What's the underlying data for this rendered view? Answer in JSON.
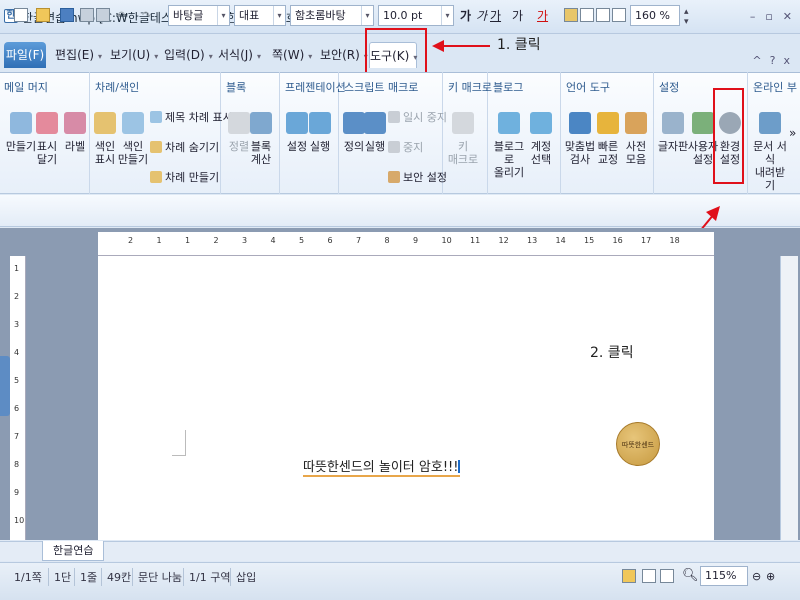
{
  "window": {
    "title": "한글연습.hwp [C:₩한글테스트01₩] - 한컴오피스 호글",
    "minimize": "–",
    "restore": "▫",
    "close": "✕"
  },
  "menu": {
    "file": "파일(F)",
    "edit": "편집(E)",
    "view": "보기(U)",
    "input": "입력(D)",
    "format": "서식(J)",
    "page": "쪽(W)",
    "security": "보안(R)",
    "tools": "도구(K)"
  },
  "ribbon_controls": {
    "collapse": "^",
    "help": "?",
    "close": "x"
  },
  "annotations": {
    "step1": "1. 클릭",
    "step2": "2. 클릭"
  },
  "ribbon": {
    "mail_merge": {
      "title": "메일 머지",
      "buttons": [
        "만들기",
        "표시\n달기",
        "라벨"
      ]
    },
    "toc": {
      "title": "차례/색인",
      "buttons": [
        "색인\n표시",
        "색인\n만들기"
      ],
      "items": [
        "제목 차례 표시",
        "차례 숨기기",
        "차례 만들기"
      ]
    },
    "block": {
      "title": "블록",
      "buttons": [
        "정렬",
        "블록\n계산"
      ]
    },
    "presentation": {
      "title": "프레젠테이션",
      "buttons": [
        "설정",
        "실행"
      ]
    },
    "script_macro": {
      "title": "스크립트 매크로",
      "buttons": [
        "정의",
        "실행"
      ],
      "items": [
        "일시 중지",
        "중지",
        "보안 설정"
      ]
    },
    "key_macro": {
      "title": "키 매크로",
      "buttons": [
        "키\n매크로"
      ]
    },
    "blog": {
      "title": "블로그",
      "buttons": [
        "블로그로\n올리기",
        "계정\n선택"
      ]
    },
    "lang_tools": {
      "title": "언어 도구",
      "buttons": [
        "맞춤법\n검사",
        "빠른\n교정",
        "사전\n모음"
      ]
    },
    "settings": {
      "title": "설정",
      "buttons": [
        "글자판",
        "사용자\n설정",
        "환경\n설정"
      ]
    },
    "online": {
      "title": "온라인 부",
      "buttons": [
        "문서 서식\n내려받기"
      ]
    },
    "more": "»"
  },
  "toolbar": {
    "style": "바탕글",
    "lang": "대표",
    "font": "함초롬바탕",
    "size": "10.0",
    "unit": "pt",
    "bold": "가",
    "italic": "가",
    "underline": "가",
    "strike": "가",
    "color": "가",
    "line_spacing": "160",
    "pct": "%"
  },
  "document": {
    "text": "따뜻한센드의 놀이터 암호!!!",
    "stamp": "따뜻한센드"
  },
  "ruler": {
    "h": [
      "2",
      "1",
      "1",
      "2",
      "3",
      "4",
      "5",
      "6",
      "7",
      "8",
      "9",
      "10",
      "11",
      "12",
      "13",
      "14",
      "15",
      "16",
      "17",
      "18"
    ],
    "v": [
      "1",
      "2",
      "3",
      "4",
      "5",
      "6",
      "7",
      "8",
      "9",
      "10"
    ]
  },
  "sheet": {
    "tab": "한글연습"
  },
  "status": {
    "page": "1/1쪽",
    "col": "1단",
    "line": "1줄",
    "char": "49칸",
    "break": "문단 나눔",
    "section": "1/1 구역",
    "mode": "삽입",
    "zoom": "115%"
  },
  "colors": {
    "accent": "#2f6fb6",
    "annotation": "#e0101a"
  }
}
